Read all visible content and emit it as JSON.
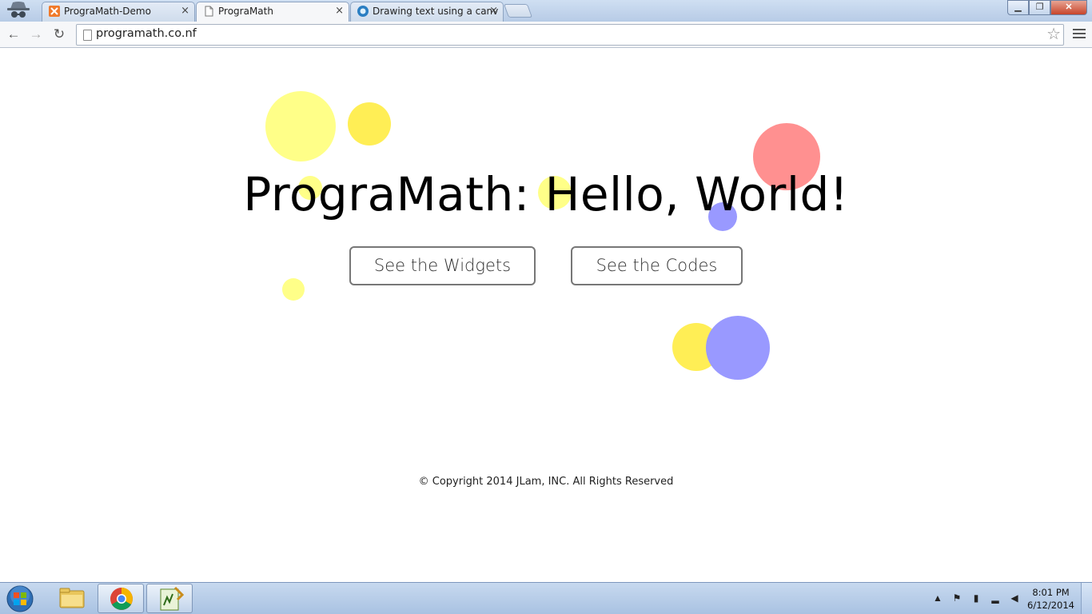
{
  "browser": {
    "tabs": [
      {
        "title": "PrograMath-Demo",
        "icon": "xampp-icon",
        "active": false
      },
      {
        "title": "PrograMath",
        "icon": "page-icon",
        "active": true
      },
      {
        "title": "Drawing text using a canv",
        "icon": "mdn-icon",
        "active": false
      }
    ],
    "close_glyph": "×",
    "address": "programath.co.nf",
    "nav": {
      "back": "←",
      "forward": "→",
      "reload": "↻"
    },
    "window_buttons": {
      "minimize": "▁",
      "maximize": "❐",
      "close": "✕"
    },
    "star_glyph": "☆"
  },
  "page": {
    "headline": "PrograMath: Hello, World!",
    "buttons": {
      "widgets": "See the Widgets",
      "codes": "See the Codes"
    },
    "footer": "© Copyright 2014 JLam, INC. All Rights Reserved",
    "bubble_colors": {
      "yellow": "#ffff88",
      "gold": "#ffee55",
      "red": "#ff9090",
      "purple": "#9999ff"
    }
  },
  "taskbar": {
    "time": "8:01 PM",
    "date": "6/12/2014",
    "tray_icons": [
      "show-hidden-icons-arrow",
      "action-center-flag-icon",
      "battery-icon",
      "network-signal-icon",
      "volume-muted-icon"
    ]
  }
}
